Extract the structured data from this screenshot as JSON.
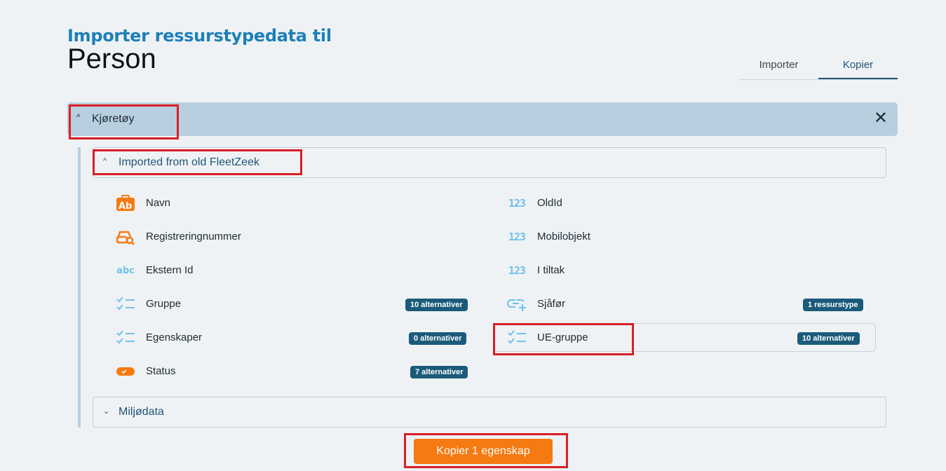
{
  "header": {
    "title": "Importer ressurstypedata til",
    "subtitle": "Person"
  },
  "tabs": [
    {
      "label": "Importer",
      "active": false
    },
    {
      "label": "Kopier",
      "active": true
    }
  ],
  "section": {
    "label": "Kjøretøy",
    "close": "✕"
  },
  "groups": {
    "imported": {
      "label": "Imported from old FleetZeek",
      "expanded": true
    },
    "miljo": {
      "label": "Miljødata",
      "expanded": false
    }
  },
  "fields_left": [
    {
      "name": "Navn",
      "icon": "text-ab-icon"
    },
    {
      "name": "Registreringnummer",
      "icon": "car-search-icon"
    },
    {
      "name": "Ekstern Id",
      "icon": "abc-icon",
      "icon_text": "abc"
    },
    {
      "name": "Gruppe",
      "icon": "checklist-icon",
      "badge": "10 alternativer"
    },
    {
      "name": "Egenskaper",
      "icon": "checklist-icon",
      "badge": "0 alternativer"
    },
    {
      "name": "Status",
      "icon": "toggle-icon",
      "badge": "7 alternativer"
    }
  ],
  "fields_right": [
    {
      "name": "OldId",
      "icon": "number-icon",
      "icon_text": "123"
    },
    {
      "name": "Mobilobjekt",
      "icon": "number-icon",
      "icon_text": "123"
    },
    {
      "name": "I tiltak",
      "icon": "number-icon",
      "icon_text": "123"
    },
    {
      "name": "Sjåfør",
      "icon": "link-add-icon",
      "badge": "1 ressurstype"
    },
    {
      "name": "UE-gruppe",
      "icon": "checklist-icon",
      "badge": "10 alternativer",
      "selected": true
    }
  ],
  "action": {
    "label": "Kopier 1 egenskap"
  },
  "colors": {
    "accent": "#f57a12",
    "title": "#1e7fb8",
    "badge": "#1b5a7a",
    "highlight": "#d91f26"
  }
}
